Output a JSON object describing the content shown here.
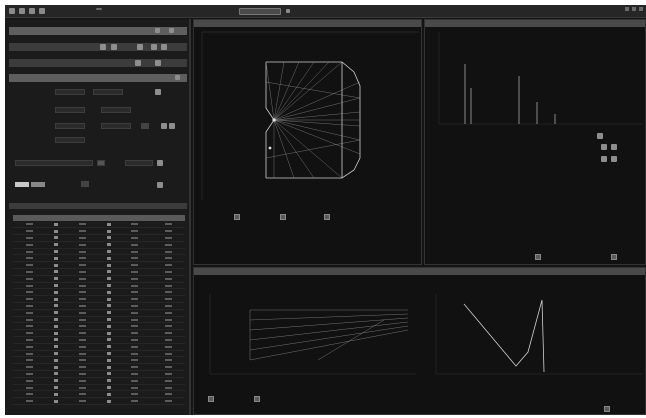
{
  "toolbar": {
    "menus": [
      "",
      "",
      "",
      "",
      "",
      "",
      "",
      ""
    ],
    "combo_value": "",
    "status_lines": [
      "",
      ""
    ]
  },
  "left_panel": {
    "sections": [
      "",
      "",
      "",
      ""
    ],
    "sub_labels": [
      "",
      "",
      "",
      "",
      "",
      "",
      ""
    ],
    "table_headers": [
      "",
      "",
      "",
      "",
      "",
      ""
    ],
    "row_count": 27
  },
  "view_panel": {
    "title": "",
    "coord_readout": "",
    "buttons": [
      "",
      "",
      ""
    ]
  },
  "plot_panel": {
    "title": "",
    "labels": [
      "",
      "",
      ""
    ],
    "bottom_buttons": [
      "",
      ""
    ]
  },
  "results_panel": {
    "title": "",
    "left_plot_title": "",
    "right_plot_title": "",
    "bottom_buttons": [
      "",
      "",
      ""
    ]
  },
  "colors": {
    "panel_bg": "#111111",
    "header_bg": "#4a4a4a",
    "accent_line": "#cfcfcf"
  }
}
